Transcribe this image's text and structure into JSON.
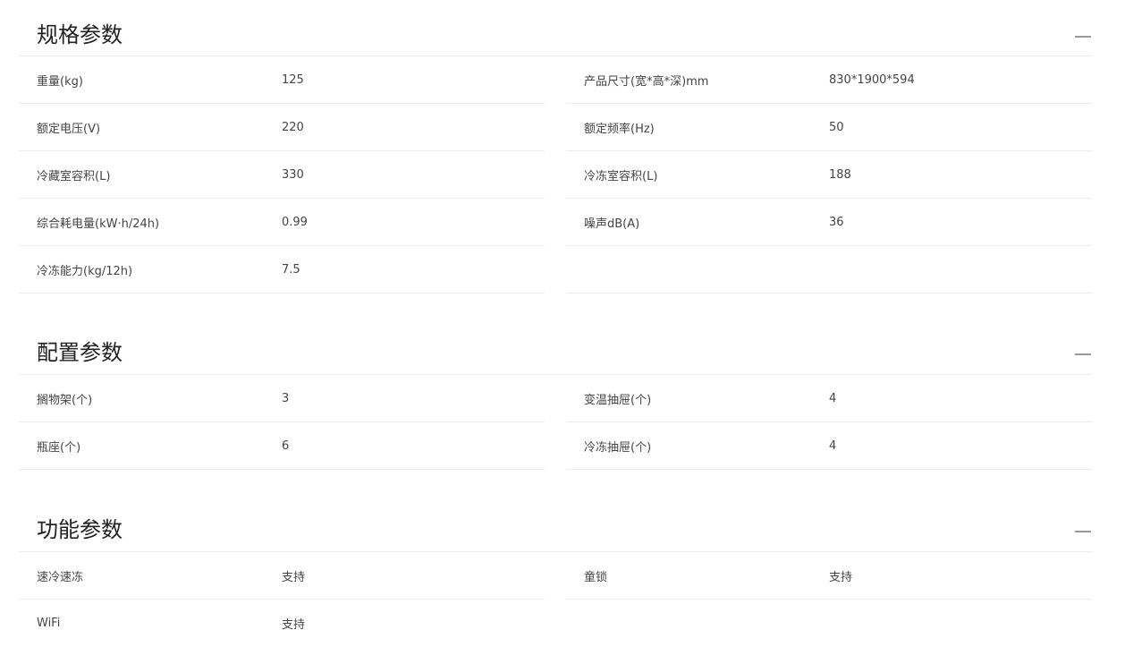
{
  "sections": [
    {
      "title": "规格参数",
      "rows": [
        {
          "label": "重量(kg)",
          "value": "125"
        },
        {
          "label": "产品尺寸(宽*高*深)mm",
          "value": "830*1900*594"
        },
        {
          "label": "额定电压(V)",
          "value": "220"
        },
        {
          "label": "额定频率(Hz)",
          "value": "50"
        },
        {
          "label": "冷藏室容积(L)",
          "value": "330"
        },
        {
          "label": "冷冻室容积(L)",
          "value": "188"
        },
        {
          "label": "综合耗电量(kW·h/24h)",
          "value": "0.99"
        },
        {
          "label": "噪声dB(A)",
          "value": "36"
        },
        {
          "label": "冷冻能力(kg/12h)",
          "value": "7.5"
        }
      ]
    },
    {
      "title": "配置参数",
      "rows": [
        {
          "label": "搁物架(个)",
          "value": "3"
        },
        {
          "label": "变温抽屉(个)",
          "value": "4"
        },
        {
          "label": "瓶座(个)",
          "value": "6"
        },
        {
          "label": "冷冻抽屉(个)",
          "value": "4"
        }
      ]
    },
    {
      "title": "功能参数",
      "rows": [
        {
          "label": "速冷速冻",
          "value": "支持"
        },
        {
          "label": "童锁",
          "value": "支持"
        },
        {
          "label": "WiFi",
          "value": "支持"
        }
      ]
    }
  ],
  "icons": {
    "collapse": "minus-icon"
  },
  "colors": {
    "divider": "#ececec",
    "title": "#222222",
    "text": "#444444",
    "icon": "#999999"
  }
}
